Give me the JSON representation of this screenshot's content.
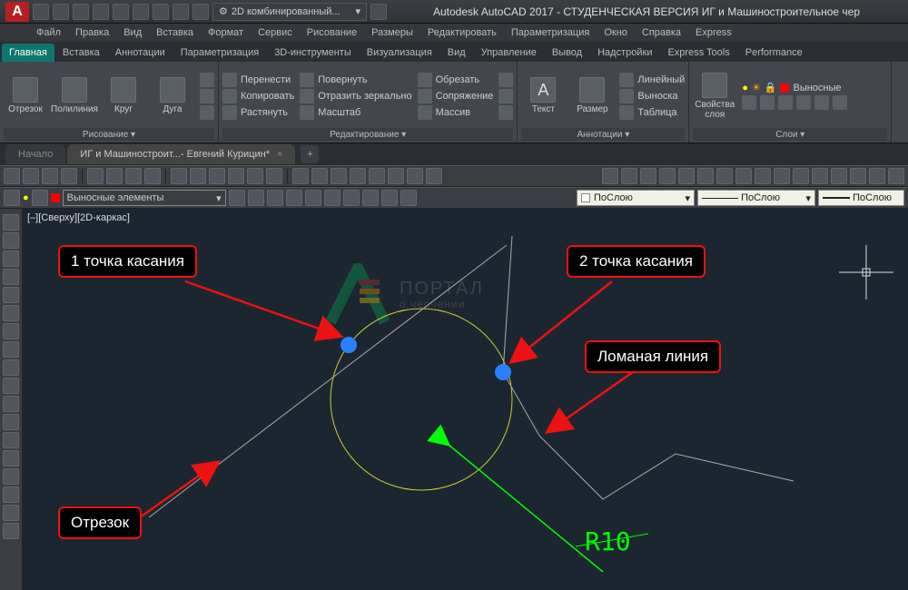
{
  "title": "Autodesk AutoCAD 2017 - СТУДЕНЧЕСКАЯ ВЕРСИЯ   ИГ и Машиностроительное чер",
  "logo": "A",
  "workspace": "2D комбинированный...",
  "menubar": [
    "Файл",
    "Правка",
    "Вид",
    "Вставка",
    "Формат",
    "Сервис",
    "Рисование",
    "Размеры",
    "Редактировать",
    "Параметризация",
    "Окно",
    "Справка",
    "Express"
  ],
  "ribbon_tabs": [
    "Главная",
    "Вставка",
    "Аннотации",
    "Параметризация",
    "3D-инструменты",
    "Визуализация",
    "Вид",
    "Управление",
    "Вывод",
    "Надстройки",
    "Express Tools",
    "Performance"
  ],
  "active_tab_index": 0,
  "ribbon": {
    "draw": {
      "line": "Отрезок",
      "polyline": "Полилиния",
      "circle": "Круг",
      "arc": "Дуга",
      "title": "Рисование ▾"
    },
    "modify": {
      "move": "Перенести",
      "copy": "Копировать",
      "stretch": "Растянуть",
      "rotate": "Повернуть",
      "mirror": "Отразить зеркально",
      "scale": "Масштаб",
      "trim": "Обрезать",
      "fillet": "Сопряжение",
      "array": "Массив",
      "title": "Редактирование ▾"
    },
    "annot": {
      "text": "Текст",
      "dim": "Размер",
      "linear": "Линейный",
      "leader": "Выноска",
      "table": "Таблица",
      "title": "Аннотации ▾"
    },
    "layer": {
      "props": "Свойства\nслоя",
      "callout": "Выносные",
      "title": "Слои ▾"
    }
  },
  "file_tabs": {
    "start": "Начало",
    "active": "ИГ и Машиностроит...- Евгений Курицин*"
  },
  "layer_combo": "Выносные элементы",
  "prop_combo": "ПоСлою",
  "view_label": "[–][Сверху][2D-каркас]",
  "callouts": {
    "p1": "1 точка касания",
    "p2": "2 точка касания",
    "polyline": "Ломаная линия",
    "seg": "Отрезок"
  },
  "dimension": "R10",
  "watermark": {
    "big": "ПОРТАЛ",
    "small": "о черчении"
  }
}
